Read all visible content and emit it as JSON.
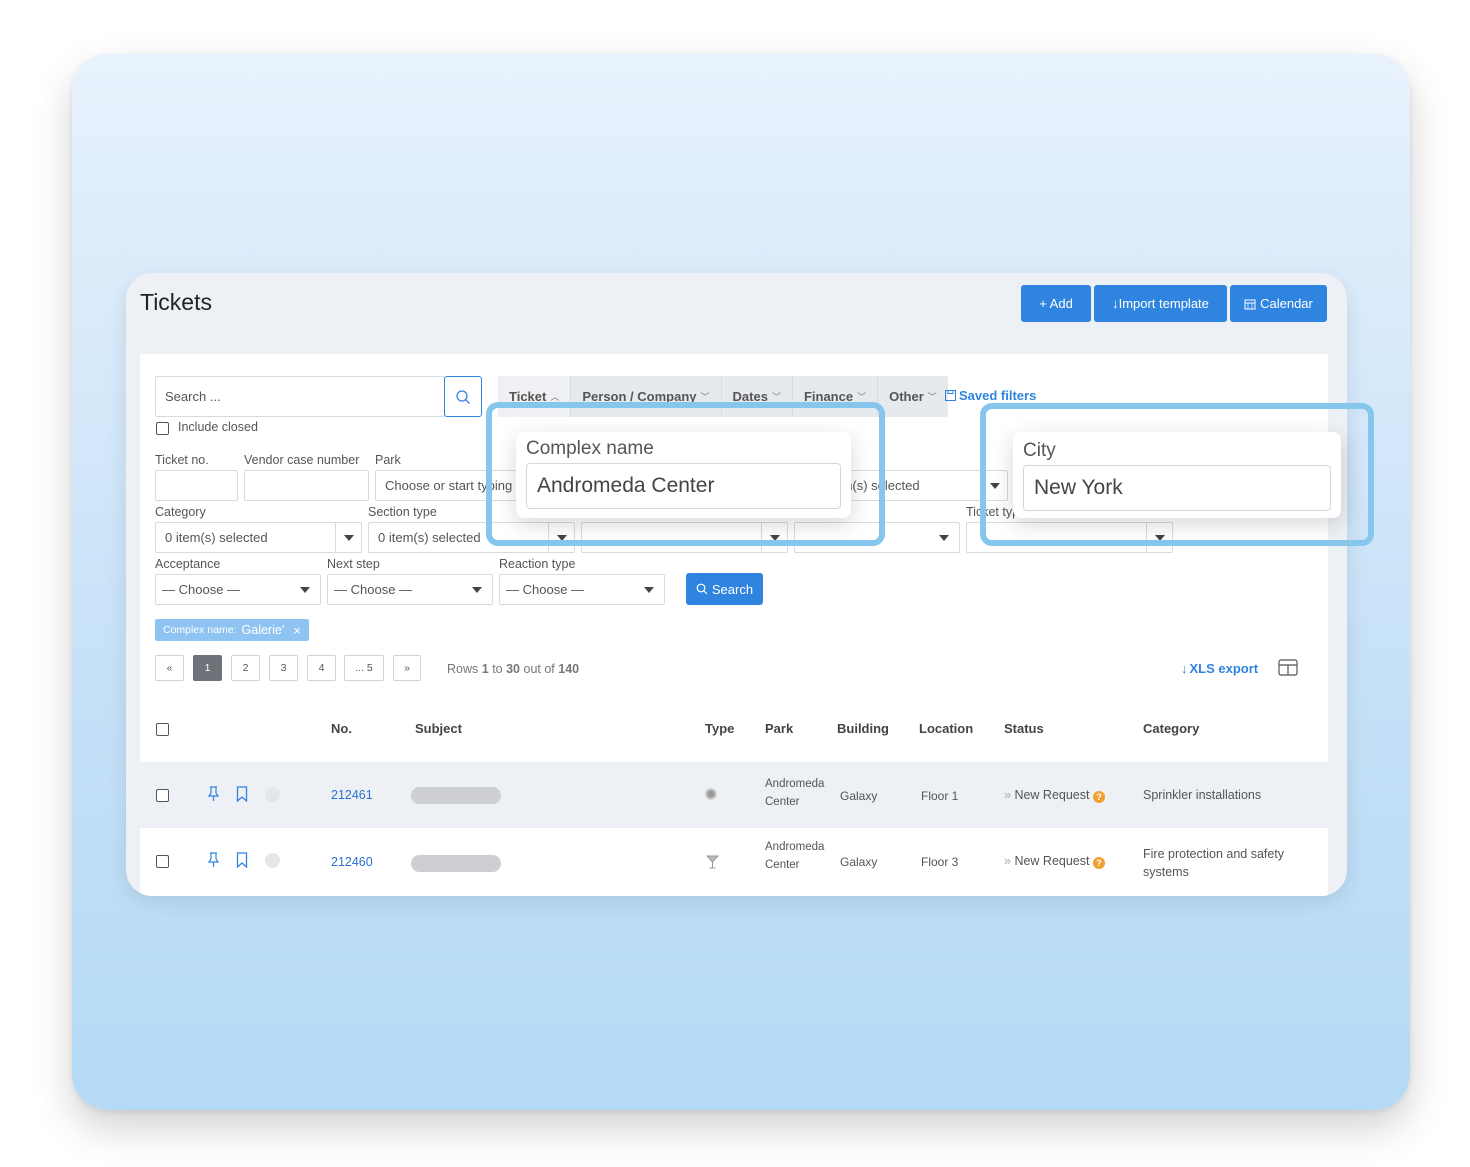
{
  "header": {
    "title": "Tickets"
  },
  "toolbar": {
    "add_label": "+ Add",
    "import_label": "↓Import template",
    "calendar_label": "Calendar"
  },
  "search": {
    "placeholder": "Search ...",
    "include_closed": "Include closed"
  },
  "filter_tabs": [
    {
      "label": "Ticket",
      "chevron": "^"
    },
    {
      "label": "Person / Company",
      "chevron": "v"
    },
    {
      "label": "Dates",
      "chevron": "v"
    },
    {
      "label": "Finance",
      "chevron": "v"
    },
    {
      "label": "Other",
      "chevron": "v"
    }
  ],
  "saved_filters": "Saved filters",
  "fields": {
    "ticket_no": "Ticket no.",
    "vendor_case": "Vendor case number",
    "park": "Park",
    "park_placeholder": "Choose or start typing",
    "hidden_selected": "0 item(s) selected",
    "category": "Category",
    "category_value": "0 item(s) selected",
    "section_type": "Section type",
    "section_value": "0 item(s) selected",
    "ticket_type": "Ticket type",
    "choose_partial": "— Choose —",
    "acceptance": "Acceptance",
    "next_step": "Next step",
    "reaction_type": "Reaction type",
    "choose": "— Choose —",
    "search_button": "Search"
  },
  "active_filter": {
    "key": "Complex name:",
    "value": "Galerie'"
  },
  "pagination": {
    "first": "«",
    "pages": [
      "1",
      "2",
      "3",
      "4",
      "... 5"
    ],
    "last": "»",
    "rows_prefix": "Rows",
    "rows_from": "1",
    "rows_to_word": "to",
    "rows_to": "30",
    "rows_out_of": "out of",
    "rows_total": "140"
  },
  "export": {
    "xls_label": "XLS export"
  },
  "table": {
    "columns": [
      "No.",
      "Subject",
      "Type",
      "Park",
      "Building",
      "Location",
      "Status",
      "Category"
    ],
    "rows": [
      {
        "no": "212461",
        "park_line1": "Andromeda",
        "park_line2": "Center",
        "building": "Galaxy",
        "location": "Floor 1",
        "status": "New Request",
        "category": "Sprinkler installations",
        "category2": ""
      },
      {
        "no": "212460",
        "park_line1": "Andromeda",
        "park_line2": "Center",
        "building": "Galaxy",
        "location": "Floor 3",
        "status": "New Request",
        "category": "Fire protection and safety",
        "category2": "systems"
      }
    ]
  },
  "popups": {
    "complex": {
      "label": "Complex name",
      "value": "Andromeda Center"
    },
    "city": {
      "label": "City",
      "value": "New York"
    }
  },
  "colors": {
    "accent": "#2f84e0",
    "highlight": "#86c6ec",
    "chip": "#8fc3f1"
  }
}
